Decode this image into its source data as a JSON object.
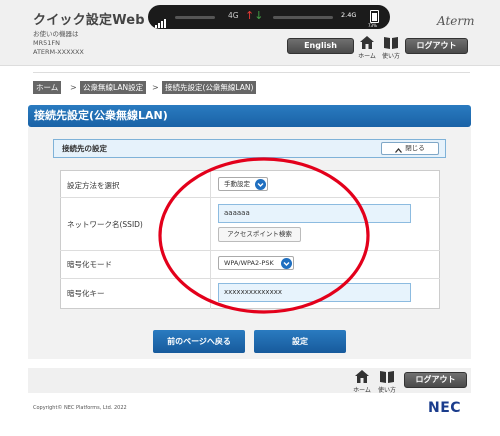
{
  "header": {
    "app_title": "クイック設定Web",
    "device_line1": "お使いの機器は",
    "device_line2": "MR51FN",
    "device_line3": "ATERM-XXXXXX",
    "brand": "Aterm",
    "english_label": "English",
    "home_label": "ホーム",
    "help_label": "使い方",
    "logout_label": "ログアウト"
  },
  "statusbar": {
    "network": "4G",
    "data_value": "2.4G",
    "battery_percent": "73%"
  },
  "breadcrumb": [
    "ホーム",
    "公衆無線LAN設定",
    "接続先設定(公衆無線LAN)"
  ],
  "page_title": "接続先設定(公衆無線LAN)",
  "section": {
    "title": "接続先の設定",
    "close_label": "閉じる"
  },
  "form": {
    "method_label": "設定方法を選択",
    "method_value": "手動設定",
    "ssid_label": "ネットワーク名(SSID)",
    "ssid_value": "aaaaaa",
    "ap_search_label": "アクセスポイント検索",
    "encryption_label": "暗号化モード",
    "encryption_value": "WPA/WPA2-PSK",
    "key_label": "暗号化キー",
    "key_value": "xxxxxxxxxxxxxx"
  },
  "buttons": {
    "back_label": "前のページへ戻る",
    "set_label": "設定"
  },
  "footer": {
    "home_label": "ホーム",
    "help_label": "使い方",
    "logout_label": "ログアウト",
    "copyright": "Copyright© NEC Platforms, Ltd. 2022",
    "logo": "NEC"
  },
  "colors": {
    "accent_blue": "#1a62a6",
    "highlight_red": "#e3001b"
  }
}
